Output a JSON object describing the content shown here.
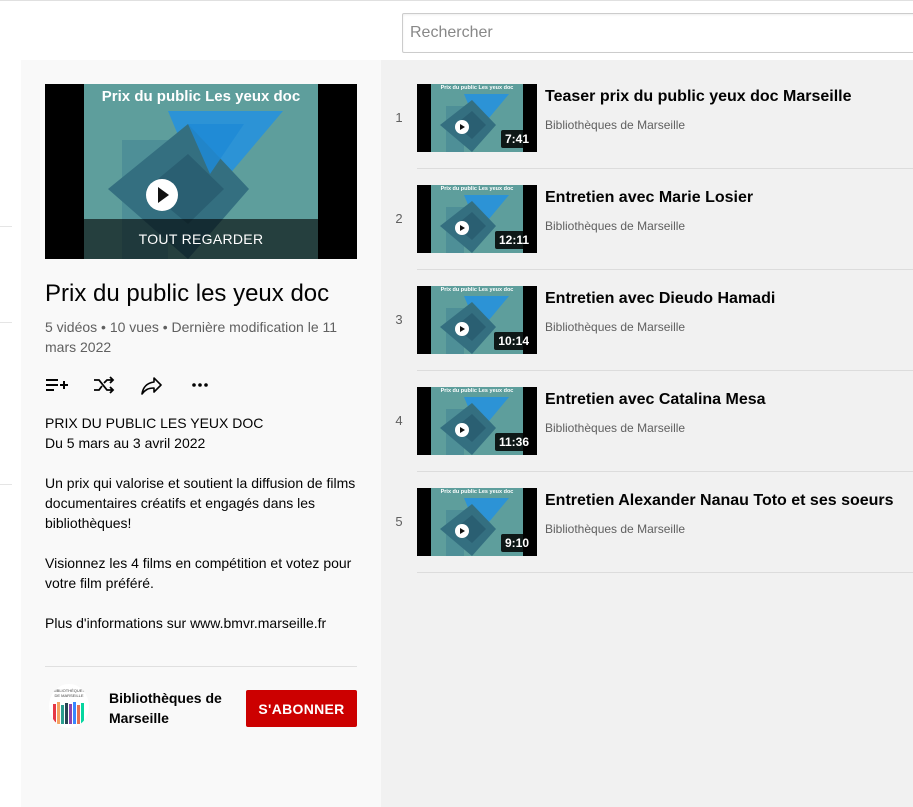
{
  "search": {
    "placeholder": "Rechercher"
  },
  "playlist": {
    "hero_thumbnail_title": "Prix du public Les yeux doc",
    "watch_all_label": "TOUT REGARDER",
    "title": "Prix du public les yeux doc",
    "stats": "5 vidéos • 10 vues • Dernière modification le 11 mars 2022",
    "actions": [
      {
        "icon": "add-to-queue-icon",
        "label": "Ajouter à la file d'attente"
      },
      {
        "icon": "shuffle-icon",
        "label": "Lecture aléatoire"
      },
      {
        "icon": "share-icon",
        "label": "Partager"
      },
      {
        "icon": "more-icon",
        "label": "Plus"
      }
    ],
    "description": {
      "line1": "PRIX DU PUBLIC LES YEUX DOC",
      "line2": "Du 5 mars au 3 avril 2022",
      "para2": "Un prix qui valorise et soutient la diffusion de films documentaires créatifs et engagés dans les bibliothèques!",
      "para3": "Visionnez les 4 films en compétition et votez pour votre film préféré.",
      "para4": "Plus d'informations sur www.bmvr.marseille.fr"
    },
    "owner": {
      "name": "Bibliothèques de Marseille",
      "avatar_text": "BIBLIOTHÈQUES DE MARSEILLE",
      "subscribe_label": "S'ABONNER"
    }
  },
  "videos": [
    {
      "index": "1",
      "title": "Teaser prix du public yeux doc Marseille",
      "channel": "Bibliothèques de Marseille",
      "duration": "7:41",
      "thumb_title": "Prix du public Les yeux doc"
    },
    {
      "index": "2",
      "title": "Entretien avec Marie Losier",
      "channel": "Bibliothèques de Marseille",
      "duration": "12:11",
      "thumb_title": "Prix du public Les yeux doc"
    },
    {
      "index": "3",
      "title": "Entretien avec Dieudo Hamadi",
      "channel": "Bibliothèques de Marseille",
      "duration": "10:14",
      "thumb_title": "Prix du public Les yeux doc"
    },
    {
      "index": "4",
      "title": "Entretien avec Catalina Mesa",
      "channel": "Bibliothèques de Marseille",
      "duration": "11:36",
      "thumb_title": "Prix du public Les yeux doc"
    },
    {
      "index": "5",
      "title": "Entretien Alexander Nanau Toto et ses soeurs",
      "channel": "Bibliothèques de Marseille",
      "duration": "9:10",
      "thumb_title": "Prix du public Les yeux doc"
    }
  ],
  "colors": {
    "subscribe_red": "#cc0000",
    "thumb_teal": "#5e9e9c",
    "thumb_blue": "#1e8ad6",
    "sidebar_bg": "#f9f9f9",
    "main_bg": "#f1f1f1"
  }
}
